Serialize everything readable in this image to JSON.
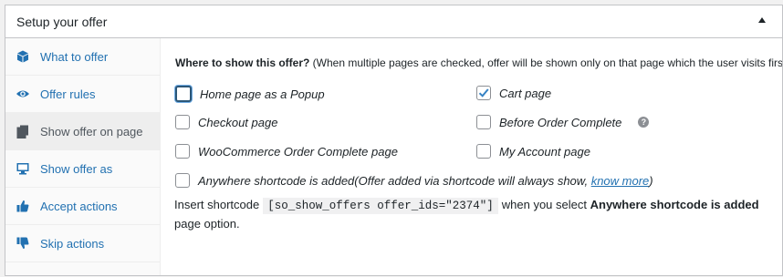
{
  "panel": {
    "title": "Setup your offer",
    "toggle_icon": "triangle-up-icon"
  },
  "sidebar": {
    "items": [
      {
        "label": "What to offer",
        "icon": "cube-icon",
        "active": false
      },
      {
        "label": "Offer rules",
        "icon": "eye-icon",
        "active": false
      },
      {
        "label": "Show offer on page",
        "icon": "pages-icon",
        "active": true
      },
      {
        "label": "Show offer as",
        "icon": "desktop-icon",
        "active": false
      },
      {
        "label": "Accept actions",
        "icon": "thumbs-up-icon",
        "active": false
      },
      {
        "label": "Skip actions",
        "icon": "thumbs-down-icon",
        "active": false
      }
    ]
  },
  "main": {
    "question_bold": "Where to show this offer?",
    "question_rest": " (When multiple pages are checked, offer will be shown only on that page which the user visits first",
    "options": [
      {
        "label": "Home page as a Popup",
        "checked": false
      },
      {
        "label": "Cart page",
        "checked": true
      },
      {
        "label": "Checkout page",
        "checked": false
      },
      {
        "label": "Before Order Complete",
        "checked": false
      },
      {
        "label": "WooCommerce Order Complete page",
        "checked": false
      },
      {
        "label": "My Account page",
        "checked": false
      }
    ],
    "help_icon": "question-circle-icon",
    "help_glyph": "?",
    "anywhere": {
      "label": "Anywhere shortcode is added",
      "note_prefix": " (Offer added via shortcode will always show, ",
      "link": "know more",
      "note_suffix": ")",
      "checked": false
    },
    "shortcode": {
      "prefix": "Insert shortcode",
      "code": "[so_show_offers offer_ids=\"2374\"]",
      "middle": "when you select",
      "bold": "Anywhere shortcode is added",
      "suffix": "page option."
    }
  }
}
